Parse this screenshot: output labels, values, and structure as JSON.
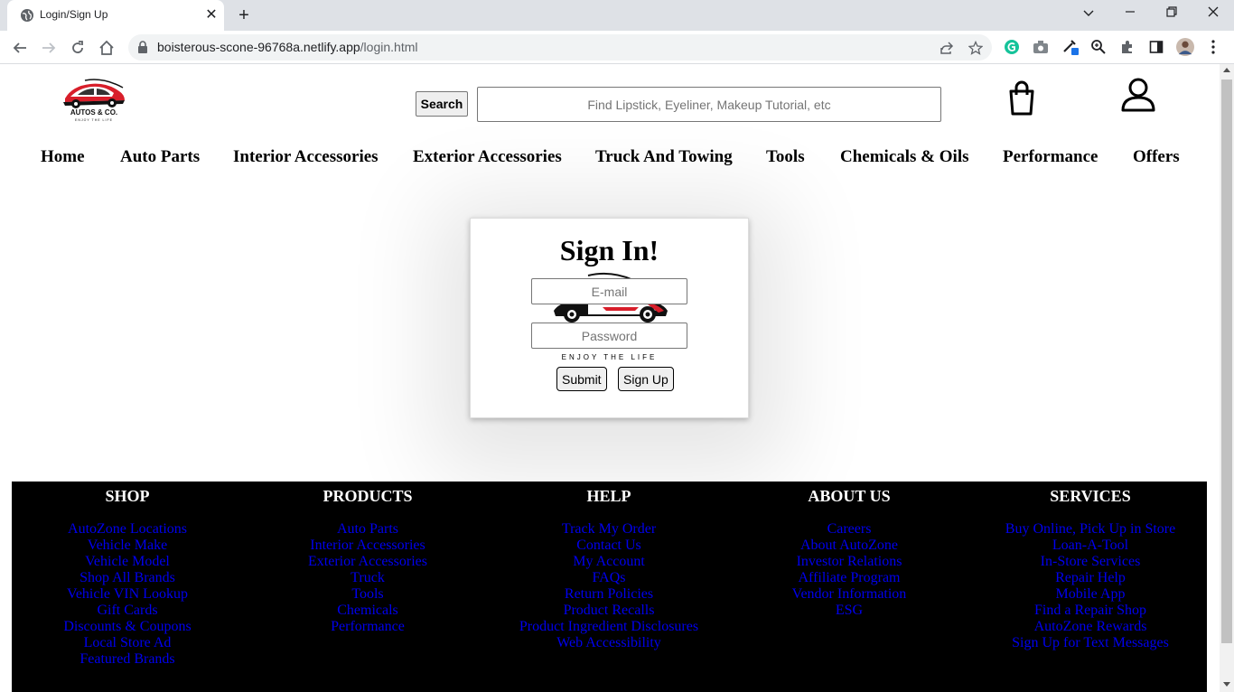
{
  "browser": {
    "tab_title": "Login/Sign Up",
    "tab_close": "✕",
    "new_tab": "+",
    "url_domain": "boisterous-scone-96768a.netlify.app",
    "url_path": "/login.html",
    "window_controls": [
      "chevron-down-icon",
      "minimize-icon",
      "restore-icon",
      "close-icon"
    ]
  },
  "header": {
    "search_label": "Search",
    "search_placeholder": "Find Lipstick, Eyeliner, Makeup Tutorial, etc",
    "logo_text": "AUTOS & CO.",
    "logo_tagline": "ENJOY THE LIFE"
  },
  "nav": {
    "items": [
      "Home",
      "Auto Parts",
      "Interior Accessories",
      "Exterior Accessories",
      "Truck And Towing",
      "Tools",
      "Chemicals & Oils",
      "Performance",
      "Offers"
    ]
  },
  "signin": {
    "title": "Sign In!",
    "email_placeholder": "E-mail",
    "password_placeholder": "Password",
    "tagline": "ENJOY THE LIFE",
    "submit_label": "Submit",
    "signup_label": "Sign Up"
  },
  "footer": {
    "columns": [
      {
        "title": "SHOP",
        "links": [
          "AutoZone Locations",
          "Vehicle Make",
          "Vehicle Model",
          "Shop All Brands",
          "Vehicle VIN Lookup",
          "Gift Cards",
          "Discounts & Coupons",
          "Local Store Ad",
          "Featured Brands"
        ]
      },
      {
        "title": "PRODUCTS",
        "links": [
          "Auto Parts",
          "Interior Accessories",
          "Exterior Accessories",
          "Truck",
          "Tools",
          "Chemicals",
          "Performance"
        ]
      },
      {
        "title": "HELP",
        "links": [
          "Track My Order",
          "Contact Us",
          "My Account",
          "FAQs",
          "Return Policies",
          "Product Recalls",
          "Product Ingredient Disclosures",
          "Web Accessibility"
        ]
      },
      {
        "title": "ABOUT US",
        "links": [
          "Careers",
          "About AutoZone",
          "Investor Relations",
          "Affiliate Program",
          "Vendor Information",
          "ESG"
        ]
      },
      {
        "title": "SERVICES",
        "links": [
          "Buy Online, Pick Up in Store",
          "Loan-A-Tool",
          "In-Store Services",
          "Repair Help",
          "Mobile App",
          "Find a Repair Shop",
          "AutoZone Rewards",
          "Sign Up for Text Messages"
        ]
      }
    ]
  },
  "colors": {
    "link": "#0000ee",
    "footer_bg": "#000000",
    "logo_red": "#d81e2a"
  }
}
